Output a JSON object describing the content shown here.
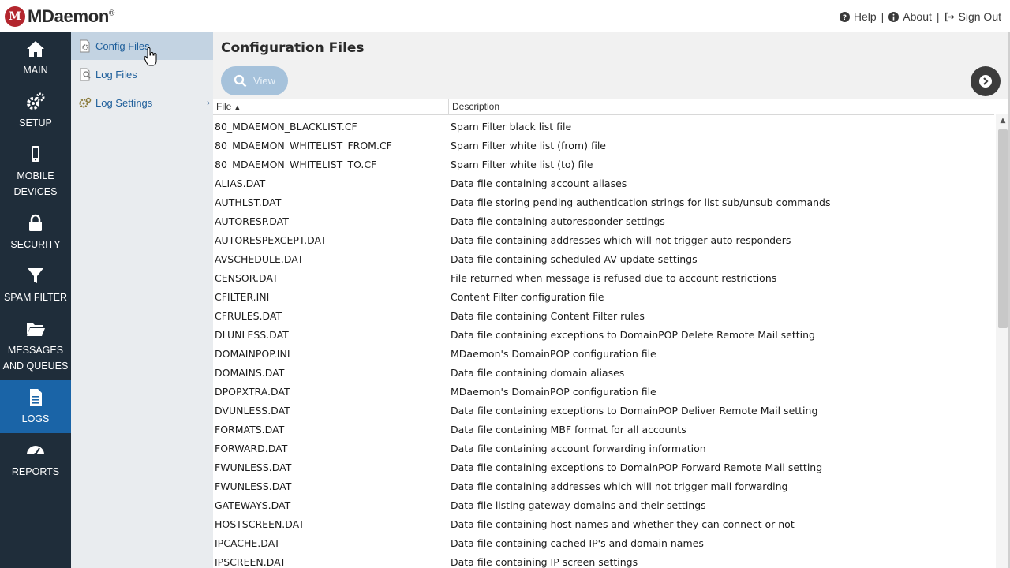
{
  "app": {
    "logo_text": "MDaemon",
    "logo_mark": "®"
  },
  "toplinks": {
    "help": "Help",
    "about": "About",
    "signout": "Sign Out"
  },
  "nav": [
    {
      "label": "MAIN",
      "icon": "home-icon"
    },
    {
      "label": "SETUP",
      "icon": "gears-icon"
    },
    {
      "label": "MOBILE DEVICES",
      "icon": "mobile-icon"
    },
    {
      "label": "SECURITY",
      "icon": "lock-icon"
    },
    {
      "label": "SPAM FILTER",
      "icon": "filter-icon"
    },
    {
      "label": "MESSAGES AND QUEUES",
      "icon": "folder-icon"
    },
    {
      "label": "LOGS",
      "icon": "document-icon",
      "active": true
    },
    {
      "label": "REPORTS",
      "icon": "dashboard-icon"
    }
  ],
  "subnav": {
    "items": [
      {
        "label": "Config Files",
        "icon": "config-file-icon",
        "active": true
      },
      {
        "label": "Log Files",
        "icon": "log-file-icon"
      },
      {
        "label": "Log Settings",
        "icon": "log-settings-icon",
        "chevron": "›"
      }
    ]
  },
  "main": {
    "title": "Configuration Files",
    "view_label": "View",
    "next_icon": "chevron-right-circle-icon"
  },
  "table": {
    "columns": {
      "file": "File",
      "description": "Description",
      "sort_indicator": "▲"
    },
    "rows": [
      {
        "file": "80_MDAEMON_BLACKLIST.CF",
        "description": "Spam Filter black list file"
      },
      {
        "file": "80_MDAEMON_WHITELIST_FROM.CF",
        "description": "Spam Filter white list (from) file"
      },
      {
        "file": "80_MDAEMON_WHITELIST_TO.CF",
        "description": "Spam Filter white list (to) file"
      },
      {
        "file": "ALIAS.DAT",
        "description": "Data file containing account aliases"
      },
      {
        "file": "AUTHLST.DAT",
        "description": "Data file storing pending authentication strings for list sub/unsub commands"
      },
      {
        "file": "AUTORESP.DAT",
        "description": "Data file containing autoresponder settings"
      },
      {
        "file": "AUTORESPEXCEPT.DAT",
        "description": "Data file containing addresses which will not trigger auto responders"
      },
      {
        "file": "AVSCHEDULE.DAT",
        "description": "Data file containing scheduled AV update settings"
      },
      {
        "file": "CENSOR.DAT",
        "description": "File returned when message is refused due to account restrictions"
      },
      {
        "file": "CFILTER.INI",
        "description": "Content Filter configuration file"
      },
      {
        "file": "CFRULES.DAT",
        "description": "Data file containing Content Filter rules"
      },
      {
        "file": "DLUNLESS.DAT",
        "description": "Data file containing exceptions to DomainPOP Delete Remote Mail setting"
      },
      {
        "file": "DOMAINPOP.INI",
        "description": "MDaemon's DomainPOP configuration file"
      },
      {
        "file": "DOMAINS.DAT",
        "description": "Data file containing domain aliases"
      },
      {
        "file": "DPOPXTRA.DAT",
        "description": "MDaemon's DomainPOP configuration file"
      },
      {
        "file": "DVUNLESS.DAT",
        "description": "Data file containing exceptions to DomainPOP Deliver Remote Mail setting"
      },
      {
        "file": "FORMATS.DAT",
        "description": "Data file containing MBF format for all accounts"
      },
      {
        "file": "FORWARD.DAT",
        "description": "Data file containing account forwarding information"
      },
      {
        "file": "FWUNLESS.DAT",
        "description": "Data file containing exceptions to DomainPOP Forward Remote Mail setting"
      },
      {
        "file": "FWUNLESS.DAT",
        "description": "Data file containing addresses which will not trigger mail forwarding"
      },
      {
        "file": "GATEWAYS.DAT",
        "description": "Data file listing gateway domains and their settings"
      },
      {
        "file": "HOSTSCREEN.DAT",
        "description": "Data file containing host names and whether they can connect or not"
      },
      {
        "file": "IPCACHE.DAT",
        "description": "Data file containing cached IP's and domain names"
      },
      {
        "file": "IPSCREEN.DAT",
        "description": "Data file containing IP screen settings"
      }
    ]
  },
  "colors": {
    "nav_bg": "#1f2d3a",
    "nav_active": "#1a64a7",
    "subnav_bg": "#e9ecef",
    "subnav_active": "#c3d3e2",
    "link": "#1f5f9b",
    "logo_red": "#b3262e"
  }
}
